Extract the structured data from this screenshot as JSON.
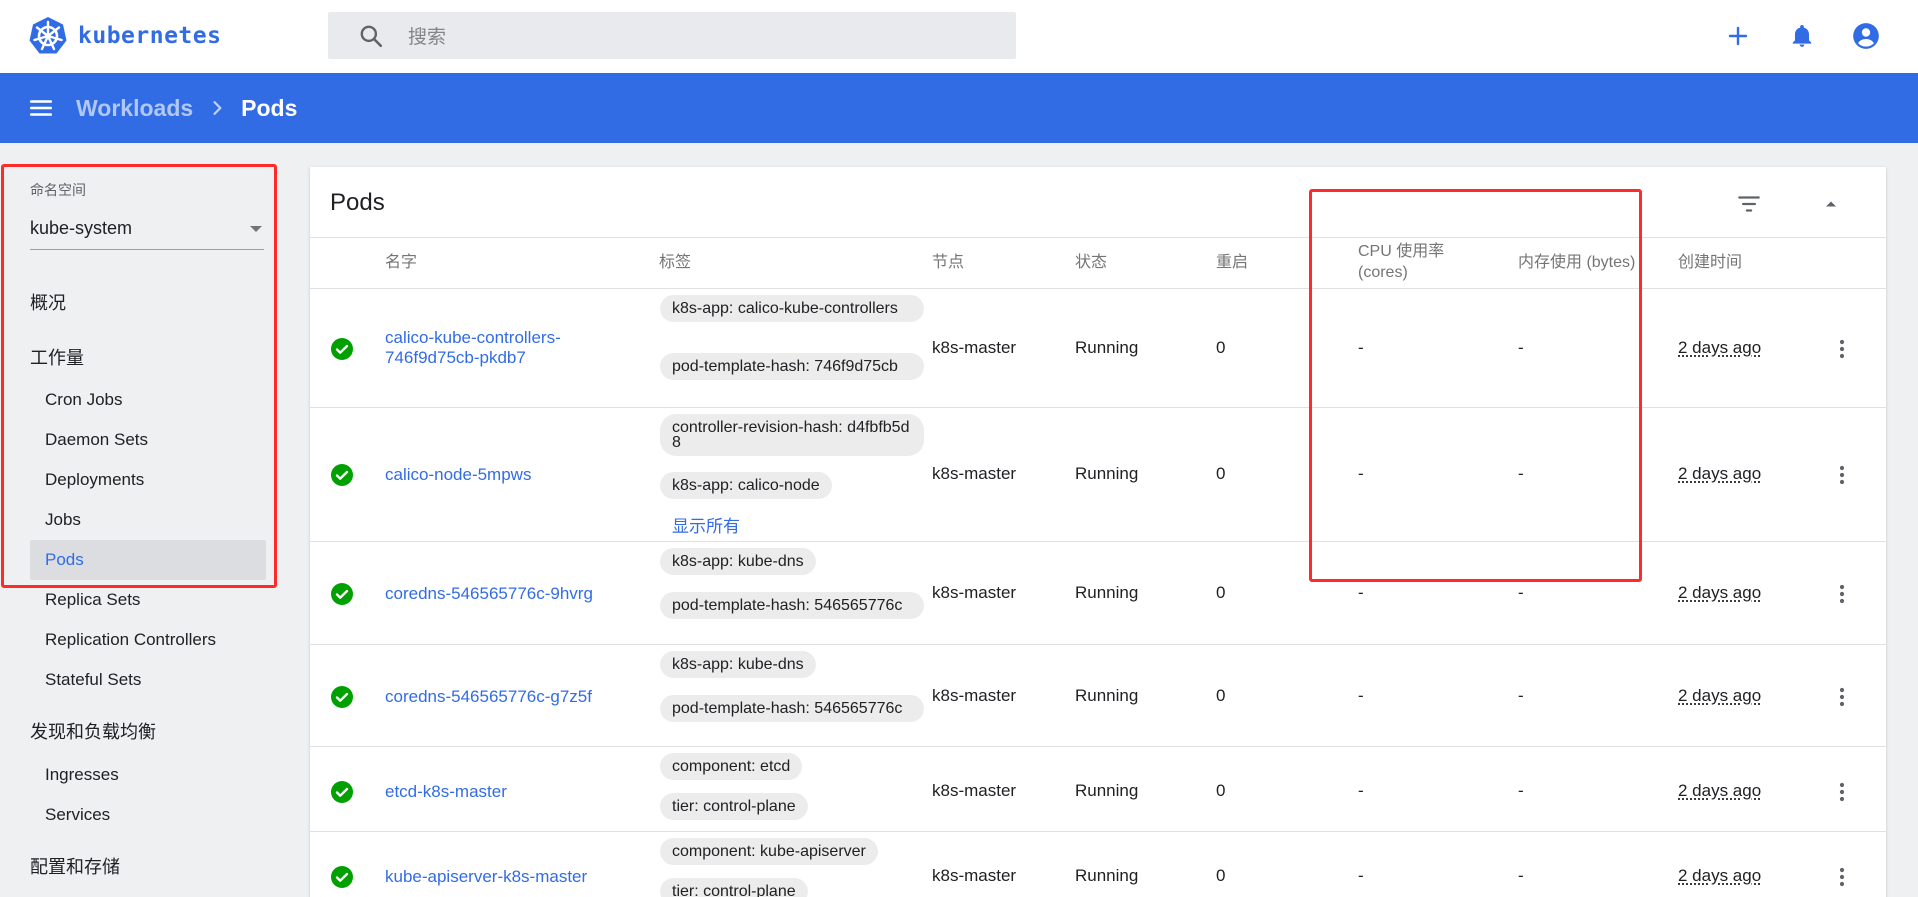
{
  "app": {
    "name": "kubernetes"
  },
  "search": {
    "placeholder": "搜索"
  },
  "breadcrumb": {
    "parent": "Workloads",
    "current": "Pods"
  },
  "sidebar": {
    "namespace_label": "命名空间",
    "namespace_value": "kube-system",
    "overview": "概况",
    "workloads": "工作量",
    "workload_items": [
      "Cron Jobs",
      "Daemon Sets",
      "Deployments",
      "Jobs",
      "Pods",
      "Replica Sets",
      "Replication Controllers",
      "Stateful Sets"
    ],
    "discovery": "发现和负载均衡",
    "discovery_items": [
      "Ingresses",
      "Services"
    ],
    "config": "配置和存储"
  },
  "pods_card": {
    "title": "Pods",
    "columns": {
      "name": "名字",
      "labels": "标签",
      "node": "节点",
      "status": "状态",
      "restarts": "重启",
      "cpu_line1": "CPU 使用率",
      "cpu_line2": "(cores)",
      "memory": "内存使用 (bytes)",
      "created": "创建时间"
    },
    "show_all": "显示所有",
    "rows": [
      {
        "name_line1": "calico-kube-controllers-",
        "name_line2": "746f9d75cb-pkdb7",
        "labels": [
          "k8s-app: calico-kube-controllers",
          "pod-template-hash: 746f9d75cb"
        ],
        "node": "k8s-master",
        "status": "Running",
        "restarts": "0",
        "cpu": "-",
        "memory": "-",
        "age": "2 days ago"
      },
      {
        "name_line1": "calico-node-5mpws",
        "labels": [
          "controller-revision-hash: d4fbfb5d8",
          "k8s-app: calico-node"
        ],
        "node": "k8s-master",
        "status": "Running",
        "restarts": "0",
        "cpu": "-",
        "memory": "-",
        "age": "2 days ago"
      },
      {
        "name_line1": "coredns-546565776c-9hvrg",
        "labels": [
          "k8s-app: kube-dns",
          "pod-template-hash: 546565776c"
        ],
        "node": "k8s-master",
        "status": "Running",
        "restarts": "0",
        "cpu": "-",
        "memory": "-",
        "age": "2 days ago"
      },
      {
        "name_line1": "coredns-546565776c-g7z5f",
        "labels": [
          "k8s-app: kube-dns",
          "pod-template-hash: 546565776c"
        ],
        "node": "k8s-master",
        "status": "Running",
        "restarts": "0",
        "cpu": "-",
        "memory": "-",
        "age": "2 days ago"
      },
      {
        "name_line1": "etcd-k8s-master",
        "labels": [
          "component: etcd",
          "tier: control-plane"
        ],
        "node": "k8s-master",
        "status": "Running",
        "restarts": "0",
        "cpu": "-",
        "memory": "-",
        "age": "2 days ago"
      },
      {
        "name_line1": "kube-apiserver-k8s-master",
        "labels": [
          "component: kube-apiserver",
          "tier: control-plane"
        ],
        "node": "k8s-master",
        "status": "Running",
        "restarts": "0",
        "cpu": "-",
        "memory": "-",
        "age": "2 days ago"
      }
    ]
  },
  "colors": {
    "brand": "#326ce5",
    "success": "#00a000",
    "highlight": "#ff2a2a"
  }
}
